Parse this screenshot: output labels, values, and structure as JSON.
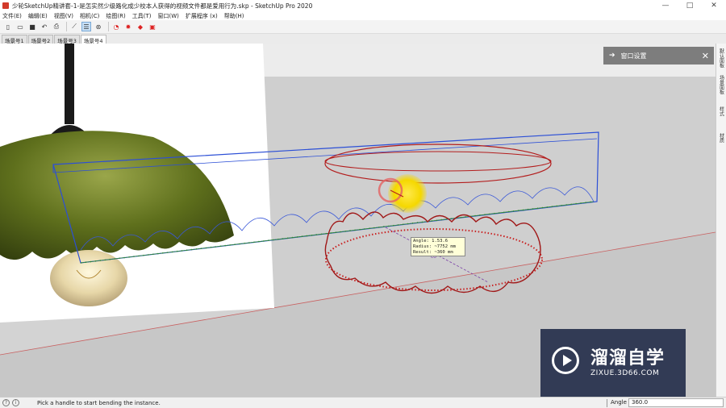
{
  "titlebar": {
    "title": "少轮SketchUp精讲套-1-是怎实然少级路化成少校本人获得的视频文件都是爱用行为.skp - SketchUp Pro 2020",
    "minimize": "—",
    "maximize": "□",
    "close": "✕"
  },
  "menu": {
    "items": [
      "文件(E)",
      "编辑(E)",
      "视图(V)",
      "相机(C)",
      "绘图(R)",
      "工具(T)",
      "窗口(W)",
      "扩展程序 (x)",
      "帮助(H)"
    ]
  },
  "toolbar": {
    "icons": [
      "new-icon",
      "open-icon",
      "save-icon",
      "undo-icon",
      "print-icon",
      "line-icon",
      "select-icon",
      "orbit-icon",
      "red-tool-1-icon",
      "red-tool-2-icon",
      "red-tool-3-icon",
      "red-tool-4-icon"
    ]
  },
  "scenes": {
    "tabs": [
      "场景号1",
      "场景号2",
      "场景号3",
      "场景号4"
    ],
    "active": 3
  },
  "tray": {
    "title": "窗口设置",
    "close": "✕"
  },
  "rightpanel": {
    "tabs": [
      "默认面板",
      "场景面板",
      "样式",
      "材质"
    ]
  },
  "tooltip": {
    "line1": "Angle:  1.53.6",
    "line2": "Radius:  ~7752 mm",
    "line3": "Result:  ~360 mm"
  },
  "status": {
    "message": "Pick a handle to start bending the instance.",
    "vcb_label": "Angle",
    "vcb_value": "360.0"
  },
  "watermark": {
    "title": "溜溜自学",
    "url": "ZIXUE.3D66.COM"
  },
  "colors": {
    "blue_frame": "#2c4fd6",
    "red_curve": "#b31d1d",
    "green_curve": "#2f8a2f",
    "cursor_yellow": "#f5d800",
    "lamp_green": "#5e6f1c"
  }
}
